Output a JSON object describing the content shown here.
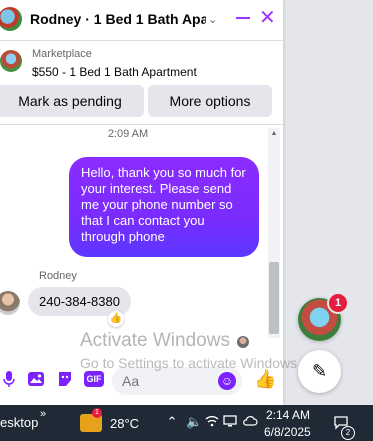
{
  "chat": {
    "title": "Rodney · 1 Bed 1 Bath Apar…",
    "title_chevron": "⌄",
    "minimize_icon": "minus-icon",
    "close_glyph": "✕"
  },
  "marketplace": {
    "label": "Marketplace",
    "listing": "$550 - 1 Bed 1 Bath Apartment"
  },
  "actions": {
    "mark_pending": "Mark as pending",
    "more_options": "More options"
  },
  "conversation": {
    "timestamp": "2:09 AM",
    "outgoing_message": "Hello, thank you so much for your interest. Please send me your phone number so that I can contact you through phone",
    "sender_name": "Rodney",
    "incoming_message": "240-384-8380",
    "reaction": "👍"
  },
  "composer": {
    "placeholder": "Aa",
    "icons": [
      "microphone-icon",
      "image-icon",
      "sticker-icon",
      "gif-icon"
    ],
    "gif_label": "GIF",
    "emoji_icon": "emoji-icon",
    "like_glyph": "👍"
  },
  "watermark": {
    "line1": "Activate Windows",
    "line2": "Go to Settings to activate Windows."
  },
  "floating": {
    "badge_count": "1",
    "compose_glyph": "✎"
  },
  "taskbar": {
    "desktop_label": "esktop",
    "desktop_arrow": "»",
    "weather_badge": "1",
    "temperature": "28°C",
    "tray_icons": [
      "chevron-up-icon",
      "volume-icon",
      "wifi-icon",
      "display-icon",
      "cloud-icon"
    ],
    "time": "2:14 AM",
    "date": "6/8/2025",
    "notification_count": "2"
  },
  "colors": {
    "accent": "#a033ff",
    "bubble_start": "#8b2bff",
    "bubble_end": "#5b37ff",
    "badge": "#e41e3f",
    "taskbar": "#1f2a36"
  }
}
